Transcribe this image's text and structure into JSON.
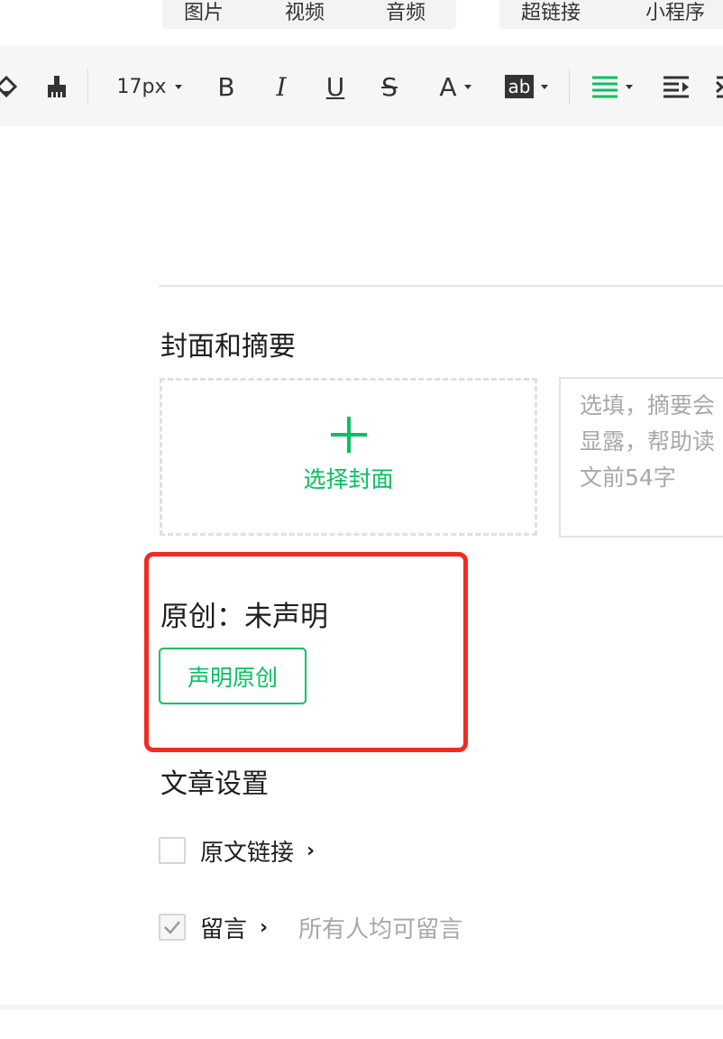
{
  "insert_bar": {
    "items": [
      "图片",
      "视频",
      "音频",
      "超链接",
      "小程序"
    ]
  },
  "toolbar": {
    "font_size": "17px",
    "bold_glyph": "B",
    "italic_glyph": "I",
    "underline_glyph": "U",
    "strike_glyph": "S",
    "font_color_glyph": "A",
    "bg_color_glyph": "ab",
    "icons": [
      "eraser-icon",
      "format-painter-icon",
      "align-justify-icon",
      "indent-icon"
    ]
  },
  "cover": {
    "section_title": "封面和摘要",
    "choose_cover_label": "选择封面",
    "summary_placeholder_lines": [
      "选填，摘要会",
      "显露，帮助读",
      "文前54字"
    ]
  },
  "original": {
    "status_text": "原创：未声明",
    "declare_button_label": "声明原创"
  },
  "settings": {
    "section_title": "文章设置",
    "source_link_label": "原文链接",
    "source_link_checked": false,
    "comment_label": "留言",
    "comment_checked": true,
    "comment_hint": "所有人均可留言"
  },
  "colors": {
    "accent_green": "#07c160",
    "highlight_red": "#f22a24"
  }
}
